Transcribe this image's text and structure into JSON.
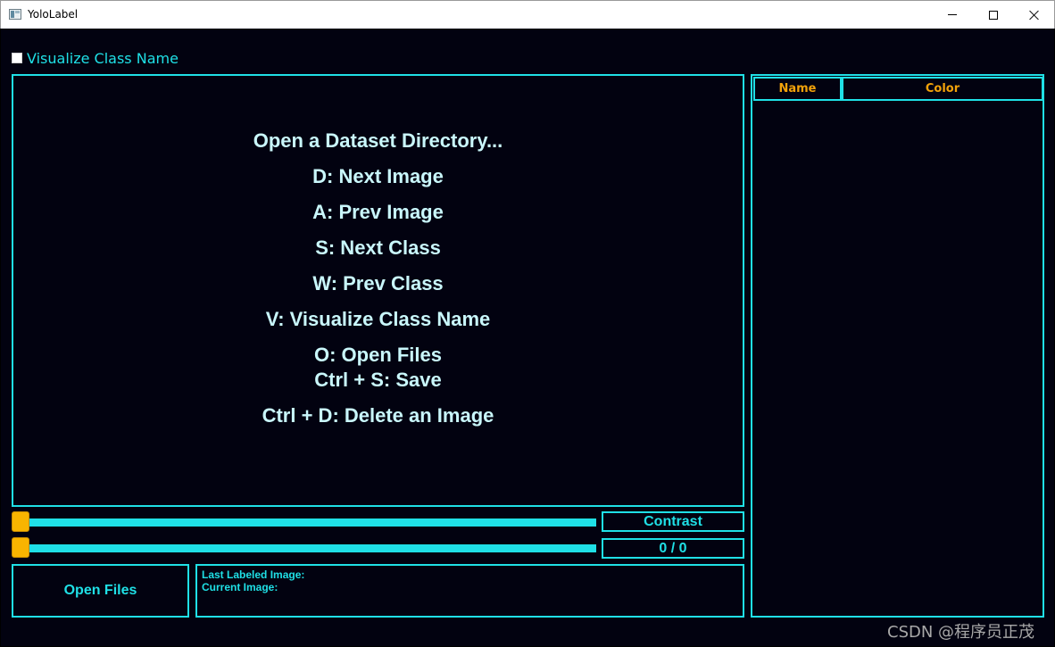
{
  "window": {
    "title": "YoloLabel",
    "icon": "app-icon",
    "buttons": [
      "minimize-icon",
      "maximize-icon",
      "close-icon"
    ]
  },
  "visualize_checkbox": {
    "label": "Visualize Class Name",
    "checked": false
  },
  "canvas": {
    "help_lines": [
      "Open a Dataset Directory...",
      "D: Next Image",
      "A: Prev Image",
      "S: Next Class",
      "W: Prev Class",
      "V: Visualize Class Name",
      "O: Open Files",
      "Ctrl + S: Save",
      "Ctrl + D: Delete an Image"
    ]
  },
  "class_table": {
    "columns": [
      "Name",
      "Color"
    ],
    "rows": []
  },
  "contrast": {
    "label": "Contrast",
    "value": 0
  },
  "image_slider": {
    "value": 0,
    "counter": "0 / 0"
  },
  "open_files_button": "Open Files",
  "info": {
    "last_labeled": "Last Labeled Image:",
    "current": "Current Image:"
  },
  "watermark": "CSDN @程序员正茂",
  "colors": {
    "accent": "#1fe0e6",
    "background": "#020210",
    "handle": "#f8b400",
    "header_text": "#f2a20a",
    "help_text": "#c9f7fb"
  }
}
